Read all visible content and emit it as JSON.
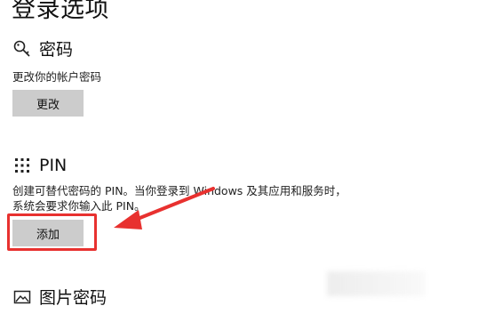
{
  "title": "登录选项",
  "password_section": {
    "icon": "key-icon",
    "heading": "密码",
    "description": "更改你的帐户密码",
    "button_label": "更改"
  },
  "pin_section": {
    "icon": "keypad-icon",
    "heading": "PIN",
    "description_line1": "创建可替代密码的 PIN。当你登录到 Windows 及其应用和服务时，",
    "description_line2": "系统会要求你输入此 PIN。",
    "button_label": "添加"
  },
  "picture_password_section": {
    "icon": "picture-icon",
    "heading": "图片密码"
  },
  "annotation": {
    "color": "#e8312f"
  }
}
